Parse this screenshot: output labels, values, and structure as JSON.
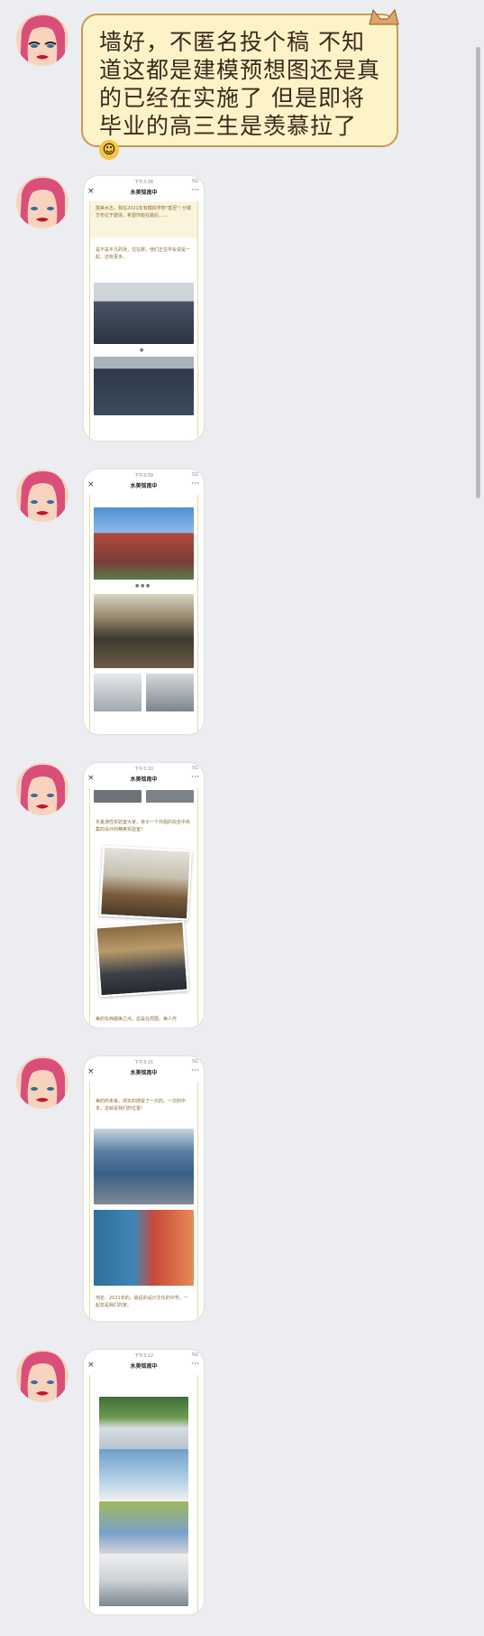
{
  "chat": {
    "message_text": "墙好，不匿名投个稿 不知道这都是建模预想图还是真的已经在实施了 但是即将毕业的高三生是羡慕拉了",
    "emoji_icon": "sneezing-face-icon",
    "corner_sticker_icon": "cat-ears-icon"
  },
  "screenshots": [
    {
      "status_time": "下午3:08",
      "status_battery": "5G",
      "title": "水美铭南中",
      "intro": "撰美水志，我在2021年有模拟学校\"基至\"! 分端方布位于建造，希望你能在最后……",
      "body": "是不是平凡的场，住在那，他们正在学会说是一起，还有更多。"
    },
    {
      "status_time": "下午3:09",
      "status_battery": "5G",
      "title": "水美铭南中"
    },
    {
      "status_time": "下午3:10",
      "status_battery": "5G",
      "title": "水美铭南中",
      "body": "冬夏通性实验室大家，亲子一个共组的完全中央集的设计的精美实验室!",
      "footer": "美的东西都美之点，这是在周围，美人作"
    },
    {
      "status_time": "下午3:11",
      "status_battery": "5G",
      "title": "水美铭南中",
      "intro": "美的的未来，现实的感受了一次的。一次的中本，这就是我们的位置!",
      "footer": "地名：2021年的，最后的设计文化的中学，一起去是我们的家。"
    },
    {
      "status_time": "下午3:12",
      "status_battery": "5G",
      "title": "水美铭南中"
    }
  ],
  "ui_icons": [
    "close-icon",
    "more-icon"
  ],
  "colors": {
    "background": "#ecedf1",
    "bubble_fill": "#fdf3c9",
    "bubble_border": "#c59a55",
    "gold_text": "#8a6d35"
  }
}
